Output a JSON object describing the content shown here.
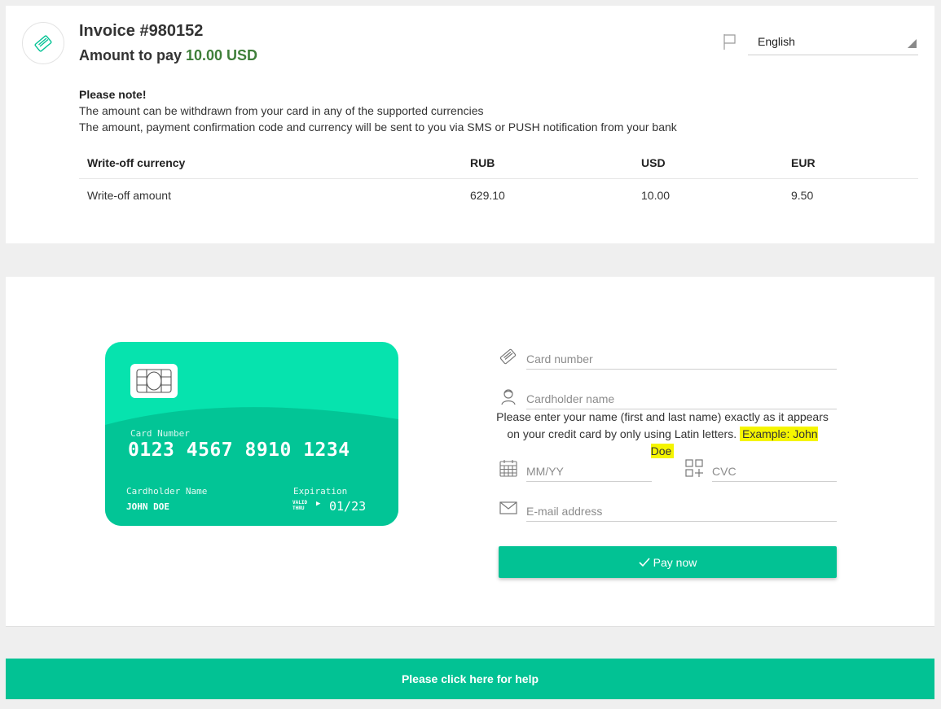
{
  "invoice": {
    "title": "Invoice #980152",
    "amount_label": "Amount to pay ",
    "amount_value": "10.00 USD"
  },
  "language": {
    "selected": "English"
  },
  "note": {
    "title": "Please note!",
    "line1": "The amount can be withdrawn from your card in any of the supported currencies",
    "line2": "The amount, payment confirmation code and currency will be sent to you via SMS or PUSH notification from your bank"
  },
  "rates_table": {
    "headers": [
      "Write-off currency",
      "RUB",
      "USD",
      "EUR"
    ],
    "row": [
      "Write-off amount",
      "629.10",
      "10.00",
      "9.50"
    ]
  },
  "card": {
    "number_label": "Card Number",
    "number": "0123 4567 8910 1234",
    "holder_label": "Cardholder Name",
    "holder": "JOHN DOE",
    "expiration_label": "Expiration",
    "valid_thru": "VALID THRU",
    "expiration": "01/23"
  },
  "form": {
    "card_number_placeholder": "Card number",
    "cardholder_placeholder": "Cardholder name",
    "name_hint": "Please enter your name (first and last name) exactly as it appears on your credit card by only using Latin letters.",
    "name_example": "Example: John Doe",
    "expiry_placeholder": "MM/YY",
    "cvc_placeholder": "CVC",
    "email_placeholder": "E-mail address",
    "pay_label": "Pay now"
  },
  "help": {
    "label": "Please click here for help"
  },
  "colors": {
    "accent": "#02c294",
    "card": "#06e3ae",
    "amount_green": "#3f7f3a",
    "highlight": "#f5f500"
  }
}
